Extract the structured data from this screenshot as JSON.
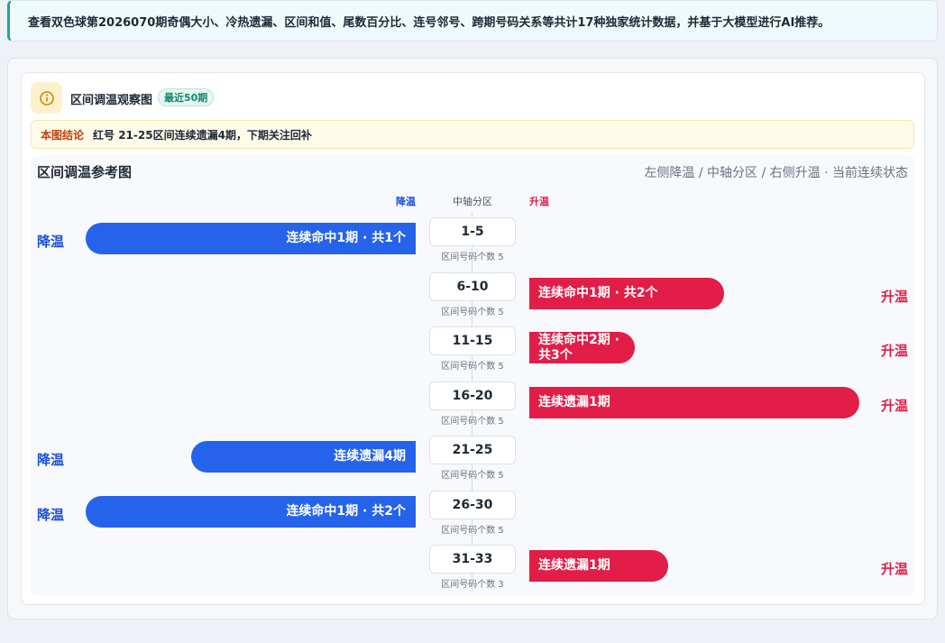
{
  "notice": "查看双色球第2026070期奇偶大小、冷热遗漏、区间和值、尾数百分比、连号邻号、跨期号码关系等共计17种独家统计数据，并基于大模型进行AI推荐。",
  "card": {
    "title": "区间调温观察图",
    "badge": "最近50期",
    "conclusion_label": "本图结论",
    "conclusion_text": "红号 21-25区间连续遗漏4期，下期关注回补"
  },
  "panel": {
    "title": "区间调温参考图",
    "subtitle": "左侧降温 / 中轴分区 / 右侧升温 · 当前连续状态",
    "col_cool": "降温",
    "col_axis": "中轴分区",
    "col_warm": "升温"
  },
  "rows": [
    {
      "zone": "1-5",
      "count": "区间号码个数 5",
      "dir": "cool",
      "side_label": "降温",
      "bar_text": "连续命中1期 · 共1个",
      "bar_fraction": 1.0
    },
    {
      "zone": "6-10",
      "count": "区间号码个数 5",
      "dir": "warm",
      "side_label": "升温",
      "bar_text": "连续命中1期 · 共2个",
      "bar_fraction": 0.59
    },
    {
      "zone": "11-15",
      "count": "区间号码个数 5",
      "dir": "warm",
      "side_label": "升温",
      "bar_text": "连续命中2期 · 共3个",
      "bar_fraction": 0.32
    },
    {
      "zone": "16-20",
      "count": "区间号码个数 5",
      "dir": "warm",
      "side_label": "升温",
      "bar_text": "连续遗漏1期",
      "bar_fraction": 1.0
    },
    {
      "zone": "21-25",
      "count": "区间号码个数 5",
      "dir": "cool",
      "side_label": "降温",
      "bar_text": "连续遗漏4期",
      "bar_fraction": 0.68
    },
    {
      "zone": "26-30",
      "count": "区间号码个数 5",
      "dir": "cool",
      "side_label": "降温",
      "bar_text": "连续命中1期 · 共2个",
      "bar_fraction": 1.0
    },
    {
      "zone": "31-33",
      "count": "区间号码个数 3",
      "dir": "warm",
      "side_label": "升温",
      "bar_text": "连续遗漏1期",
      "bar_fraction": 0.42
    }
  ],
  "colors": {
    "cool": "#2563eb",
    "warm": "#e11d48",
    "accent": "#1aa89a"
  }
}
